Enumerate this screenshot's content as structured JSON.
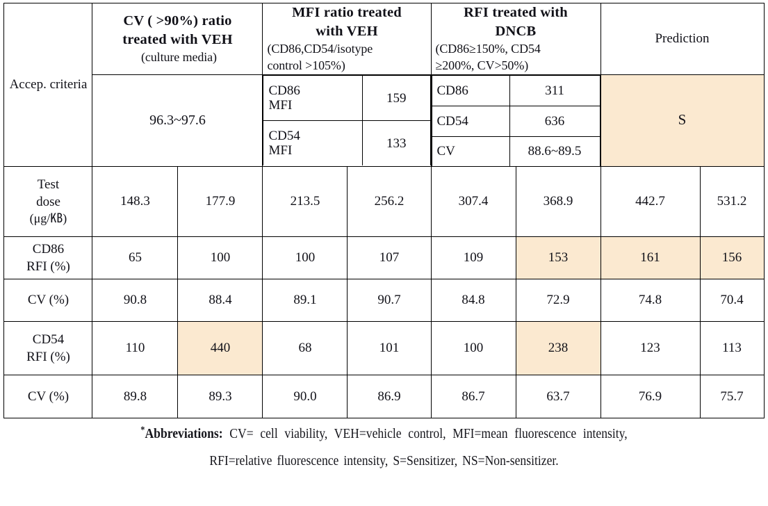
{
  "table": {
    "row_labels": {
      "accep_criteria": "Accep.\ncriteria",
      "accep_criteria_l1": "Accep.",
      "accep_criteria_l2": "criteria",
      "test_dose_l1": "Test",
      "test_dose_l2": "dose",
      "test_dose_l3": "(μg/㎅)",
      "cd86_rfi_l1": "CD86",
      "cd86_rfi_l2": "RFI (%)",
      "cv1": "CV (%)",
      "cd54_rfi_l1": "CD54",
      "cd54_rfi_l2": "RFI (%)",
      "cv2": "CV (%)"
    },
    "headers": {
      "cv_ratio": {
        "line1": "CV ( >90%) ratio",
        "line2": "treated with VEH",
        "line3": "(culture media)",
        "value": "96.3~97.6"
      },
      "mfi_ratio": {
        "line1": "MFI ratio treated",
        "line2": "with VEH",
        "line3": "(CD86,CD54/isotype",
        "line4": "control >105%)",
        "rows": [
          {
            "label_a": "CD86",
            "label_b": "MFI",
            "value": "159"
          },
          {
            "label_a": "CD54",
            "label_b": "MFI",
            "value": "133"
          }
        ]
      },
      "rfi_dncb": {
        "line1": "RFI treated with",
        "line2": "DNCB",
        "line3": "(CD86≥150%, CD54",
        "line4": "≥200%, CV>50%)",
        "rows": [
          {
            "label": "CD86",
            "value": "311"
          },
          {
            "label": "CD54",
            "value": "636"
          },
          {
            "label": "CV",
            "value": "88.6~89.5"
          }
        ]
      },
      "prediction": {
        "title": "Prediction",
        "value": "S"
      }
    },
    "data_rows": [
      {
        "label_lines": [
          "Test",
          "dose",
          "(μg/㎅)"
        ],
        "cells": [
          {
            "value": "148.3",
            "highlight": false,
            "blue": false
          },
          {
            "value": "177.9",
            "highlight": false,
            "blue": false
          },
          {
            "value": "213.5",
            "highlight": false,
            "blue": false
          },
          {
            "value": "256.2",
            "highlight": false,
            "blue": false
          },
          {
            "value": "307.4",
            "highlight": false,
            "blue": false
          },
          {
            "value": "368.9",
            "highlight": false,
            "blue": false
          },
          {
            "value": "442.7",
            "highlight": false,
            "blue": false
          },
          {
            "value": "531.2",
            "highlight": false,
            "blue": false
          }
        ]
      },
      {
        "label_lines": [
          "CD86",
          "RFI (%)"
        ],
        "cells": [
          {
            "value": "65",
            "highlight": false,
            "blue": false
          },
          {
            "value": "100",
            "highlight": false,
            "blue": false
          },
          {
            "value": "100",
            "highlight": false,
            "blue": false
          },
          {
            "value": "107",
            "highlight": false,
            "blue": false
          },
          {
            "value": "109",
            "highlight": false,
            "blue": false
          },
          {
            "value": "153",
            "highlight": true,
            "blue": true
          },
          {
            "value": "161",
            "highlight": true,
            "blue": true
          },
          {
            "value": "156",
            "highlight": true,
            "blue": true
          }
        ]
      },
      {
        "label_lines": [
          "CV (%)"
        ],
        "cells": [
          {
            "value": "90.8",
            "highlight": false,
            "blue": false
          },
          {
            "value": "88.4",
            "highlight": false,
            "blue": false
          },
          {
            "value": "89.1",
            "highlight": false,
            "blue": false
          },
          {
            "value": "90.7",
            "highlight": false,
            "blue": false
          },
          {
            "value": "84.8",
            "highlight": false,
            "blue": false
          },
          {
            "value": "72.9",
            "highlight": false,
            "blue": false
          },
          {
            "value": "74.8",
            "highlight": false,
            "blue": false
          },
          {
            "value": "70.4",
            "highlight": false,
            "blue": false
          }
        ]
      },
      {
        "label_lines": [
          "CD54",
          "RFI (%)"
        ],
        "cells": [
          {
            "value": "110",
            "highlight": false,
            "blue": false
          },
          {
            "value": "440",
            "highlight": true,
            "blue": true
          },
          {
            "value": "68",
            "highlight": false,
            "blue": false
          },
          {
            "value": "101",
            "highlight": false,
            "blue": false
          },
          {
            "value": "100",
            "highlight": false,
            "blue": false
          },
          {
            "value": "238",
            "highlight": true,
            "blue": true
          },
          {
            "value": "123",
            "highlight": false,
            "blue": false
          },
          {
            "value": "113",
            "highlight": false,
            "blue": false
          }
        ]
      },
      {
        "label_lines": [
          "CV (%)"
        ],
        "cells": [
          {
            "value": "89.8",
            "highlight": false,
            "blue": false
          },
          {
            "value": "89.3",
            "highlight": false,
            "blue": false
          },
          {
            "value": "90.0",
            "highlight": false,
            "blue": false
          },
          {
            "value": "86.9",
            "highlight": false,
            "blue": false
          },
          {
            "value": "86.7",
            "highlight": false,
            "blue": false
          },
          {
            "value": "63.7",
            "highlight": false,
            "blue": false
          },
          {
            "value": "76.9",
            "highlight": false,
            "blue": false
          },
          {
            "value": "75.7",
            "highlight": false,
            "blue": false
          }
        ]
      }
    ]
  },
  "footnote": {
    "marker": "*",
    "line1_bold": "Abbreviations:",
    "line1_rest": "CV= cell viability, VEH=vehicle control, MFI=mean fluorescence intensity,",
    "line2": "RFI=relative fluorescence intensity, S=Sensitizer, NS=Non-sensitizer."
  },
  "colors": {
    "highlight_bg": "#fbe9d0",
    "accent_text": "#3322d8",
    "border": "#000000",
    "text": "#111118"
  }
}
